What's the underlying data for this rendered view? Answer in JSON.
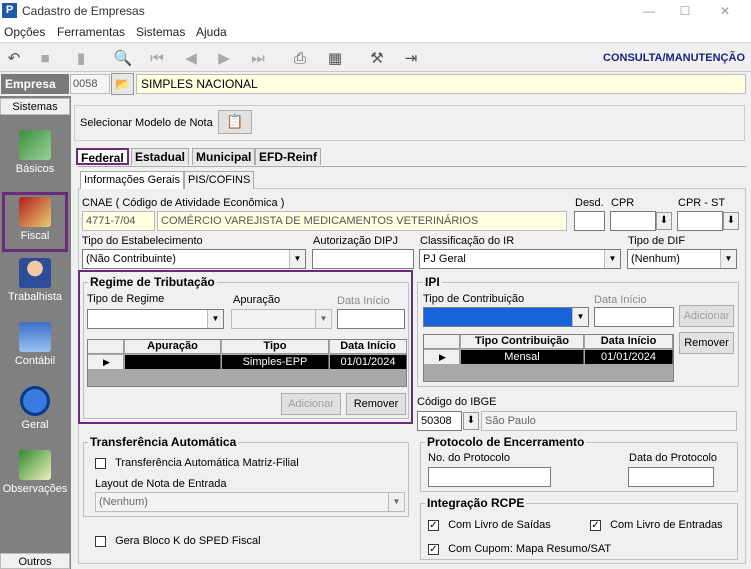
{
  "window": {
    "title": "Cadastro de Empresas",
    "app_icon": "P"
  },
  "menu": [
    "Opções",
    "Ferramentas",
    "Sistemas",
    "Ajuda"
  ],
  "toolbar": {
    "mode": "CONSULTA/MANUTENÇÃO"
  },
  "empresa": {
    "label": "Empresa",
    "code": "0058",
    "name": "SIMPLES NACIONAL"
  },
  "sidebar": {
    "header": "Sistemas",
    "footer": "Outros",
    "items": [
      {
        "label": "Básicos",
        "icon": "basicos-icon",
        "selected": false
      },
      {
        "label": "Fiscal",
        "icon": "fiscal-icon",
        "selected": true
      },
      {
        "label": "Trabalhista",
        "icon": "trabalhista-icon",
        "selected": false
      },
      {
        "label": "Contábil",
        "icon": "contabil-icon",
        "selected": false
      },
      {
        "label": "Geral",
        "icon": "geral-icon",
        "selected": false
      },
      {
        "label": "Observações",
        "icon": "observacoes-icon",
        "selected": false
      }
    ]
  },
  "modelo_nota": {
    "label": "Selecionar Modelo de Nota"
  },
  "tabs": [
    "Federal",
    "Estadual",
    "Municipal",
    "EFD-Reinf"
  ],
  "subtabs": [
    "Informações Gerais",
    "PIS/COFINS"
  ],
  "cnae": {
    "label": "CNAE ( Código de  Atividade Econômica )",
    "code": "4771-7/04",
    "desc": "COMÉRCIO VAREJISTA DE MEDICAMENTOS VETERINÁRIOS"
  },
  "desd": {
    "label": "Desd.",
    "value": ""
  },
  "cpr": {
    "label": "CPR",
    "value": ""
  },
  "cpr_st": {
    "label": "CPR - ST",
    "value": ""
  },
  "tipo_estab": {
    "label": "Tipo do Estabelecimento",
    "value": "(Não Contribuinte)"
  },
  "aut_dipj": {
    "label": "Autorização DIPJ",
    "value": ""
  },
  "class_ir": {
    "label": "Classificação do IR",
    "value": "PJ Geral"
  },
  "tipo_dif": {
    "label": "Tipo de DIF",
    "value": "(Nenhum)"
  },
  "regime": {
    "title": "Regime de Tributação",
    "tipo_label": "Tipo de Regime",
    "apuracao_label": "Apuração",
    "data_label": "Data Início",
    "columns": [
      "Apuração",
      "Tipo",
      "Data Início"
    ],
    "rows": [
      {
        "apuracao": "",
        "tipo": "Simples-EPP",
        "data": "01/01/2024"
      }
    ],
    "btn_add": "Adicionar",
    "btn_remove": "Remover"
  },
  "ipi": {
    "title": "IPI",
    "tipo_label": "Tipo de Contribuição",
    "data_label": "Data Início",
    "columns": [
      "Tipo Contribuição",
      "Data Início"
    ],
    "rows": [
      {
        "tipo": "Mensal",
        "data": "01/01/2024"
      }
    ],
    "btn_add": "Adicionar",
    "btn_remove": "Remover"
  },
  "ibge": {
    "label": "Código do IBGE",
    "code": "50308",
    "city": "São Paulo"
  },
  "transf": {
    "title": "Transferência Automática",
    "check_label": "Transferência Automática Matriz-Filial",
    "checked": false,
    "layout_label": "Layout de Nota de Entrada",
    "layout_value": "(Nenhum)"
  },
  "bloco_k": {
    "label": "Gera Bloco K do SPED Fiscal",
    "checked": false
  },
  "protocolo": {
    "title": "Protocolo de Encerramento",
    "num_label": "No. do Protocolo",
    "data_label": "Data do Protocolo"
  },
  "rcpe": {
    "title": "Integração RCPE",
    "items": [
      {
        "label": "Com Livro de Saídas",
        "checked": true
      },
      {
        "label": "Com Livro de Entradas",
        "checked": true
      },
      {
        "label": "Com Cupom: Mapa Resumo/SAT",
        "checked": true
      }
    ]
  },
  "colors": {
    "highlight": "#6b2a7a",
    "field_yellow": "#ffffe1",
    "mode_text": "#1a237e",
    "sidebar": "#808080"
  }
}
